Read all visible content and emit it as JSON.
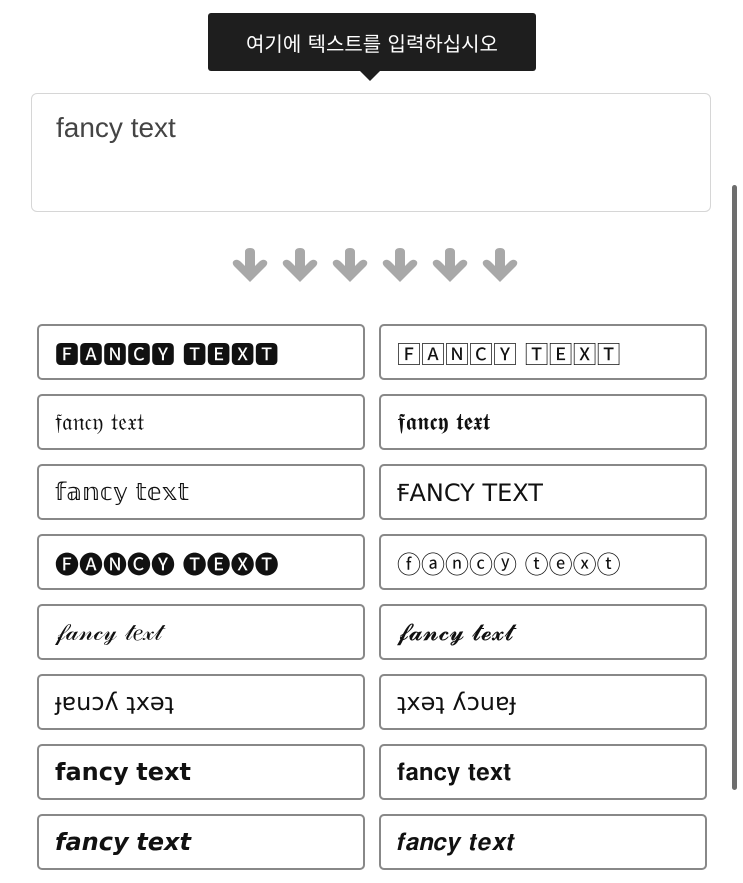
{
  "tooltip": "여기에 텍스트를 입력하십시오",
  "input": {
    "value": "fancy text"
  },
  "arrow_icon": "arrow-down-icon",
  "arrow_color": "#a8a8a8",
  "results": [
    "🅵🅰🅽🅲🆈 🆃🅴🆇🆃",
    "🄵🄰🄽🄲🅈 🅃🄴🅇🅃",
    "𝔣𝔞𝔫𝔠𝔶 𝔱𝔢𝔵𝔱",
    "𝖋𝖆𝖓𝖈𝖞 𝖙𝖊𝖝𝖙",
    "𝕗𝕒𝕟𝕔𝕪 𝕥𝕖𝕩𝕥",
    "ꞘANCY TEXT",
    "🅕🅐🅝🅒🅨 🅣🅔🅧🅣",
    "ⓕⓐⓝⓒⓨ ⓣⓔⓧⓣ",
    "𝒻𝒶𝓃𝒸𝓎 𝓉𝑒𝓍𝓉",
    "𝓯𝓪𝓷𝓬𝔂 𝓽𝓮𝔁𝓽",
    "ɟɐuɔʎ ʇxǝʇ",
    "ʇxǝʇ ʎɔuɐɟ",
    "𝗳𝗮𝗻𝗰𝘆 𝘁𝗲𝘅𝘁",
    "𝐟𝐚𝐧𝐜𝐲 𝐭𝐞𝐱𝐭",
    "𝙛𝙖𝙣𝙘𝙮 𝙩𝙚𝙭𝙩",
    "𝒇𝒂𝒏𝒄𝒚 𝒕𝒆𝒙𝒕"
  ]
}
